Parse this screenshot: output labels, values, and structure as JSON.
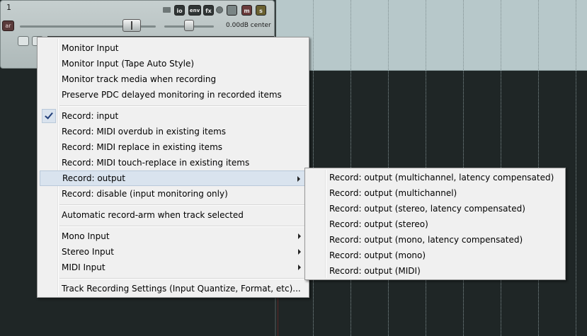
{
  "track": {
    "number": "1",
    "buttons": {
      "io": "io",
      "env": "env",
      "fx": "fx",
      "mute": "m",
      "solo": "s"
    },
    "arm_label": "ar",
    "volume_readout": "0.00dB center",
    "icons": [
      "folder-icon",
      "phase-icon",
      "route-icon",
      "mute-icon",
      "solo-icon"
    ]
  },
  "context_menu": {
    "items": [
      {
        "label": "Monitor Input"
      },
      {
        "label": "Monitor Input (Tape Auto Style)"
      },
      {
        "label": "Monitor track media when recording"
      },
      {
        "label": "Preserve PDC delayed monitoring in recorded items"
      },
      {
        "label": "Record: input",
        "checked": true
      },
      {
        "label": "Record: MIDI overdub in existing items"
      },
      {
        "label": "Record: MIDI replace in existing items"
      },
      {
        "label": "Record: MIDI touch-replace in existing items"
      },
      {
        "label": "Record: output",
        "submenu": true,
        "highlighted": true
      },
      {
        "label": "Record: disable (input monitoring only)"
      },
      {
        "label": "Automatic record-arm when track selected"
      },
      {
        "label": "Mono Input",
        "submenu": true
      },
      {
        "label": "Stereo Input",
        "submenu": true
      },
      {
        "label": "MIDI Input",
        "submenu": true
      },
      {
        "label": "Track Recording Settings (Input Quantize, Format, etc)..."
      }
    ]
  },
  "submenu": {
    "items": [
      {
        "label": "Record: output (multichannel, latency compensated)"
      },
      {
        "label": "Record: output (multichannel)"
      },
      {
        "label": "Record: output (stereo, latency compensated)"
      },
      {
        "label": "Record: output (stereo)"
      },
      {
        "label": "Record: output (mono, latency compensated)"
      },
      {
        "label": "Record: output (mono)"
      },
      {
        "label": "Record: output (MIDI)"
      }
    ]
  },
  "colors": {
    "background": "#1f2626",
    "arrange_track": "#b7c8ca",
    "menu_bg": "#f0f0f0",
    "highlight": "#d9e3ee",
    "mute_button": "#6a3a3a",
    "solo_button": "#6a6030"
  }
}
